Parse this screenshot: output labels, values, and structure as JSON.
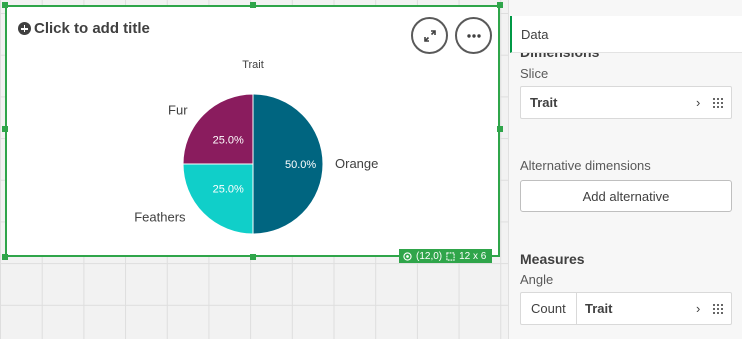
{
  "chart_object": {
    "title_placeholder": "Click to add title",
    "position_badge": "(12,0)",
    "size_badge": "12 x 6"
  },
  "chart_data": {
    "type": "pie",
    "title": "Trait",
    "slices": [
      {
        "label": "Orange",
        "value": 50.0,
        "display": "50.0%",
        "color": "#006580"
      },
      {
        "label": "Feathers",
        "value": 25.0,
        "display": "25.0%",
        "color": "#10cfc9"
      },
      {
        "label": "Fur",
        "value": 25.0,
        "display": "25.0%",
        "color": "#8a1c5e"
      }
    ]
  },
  "panel": {
    "tab_label": "Data",
    "dimensions_heading": "Dimensions",
    "slice_label": "Slice",
    "slice_field": "Trait",
    "alt_dimensions_label": "Alternative dimensions",
    "add_alternative_label": "Add alternative",
    "measures_heading": "Measures",
    "angle_label": "Angle",
    "measure_aggr": "Count",
    "measure_field": "Trait"
  }
}
